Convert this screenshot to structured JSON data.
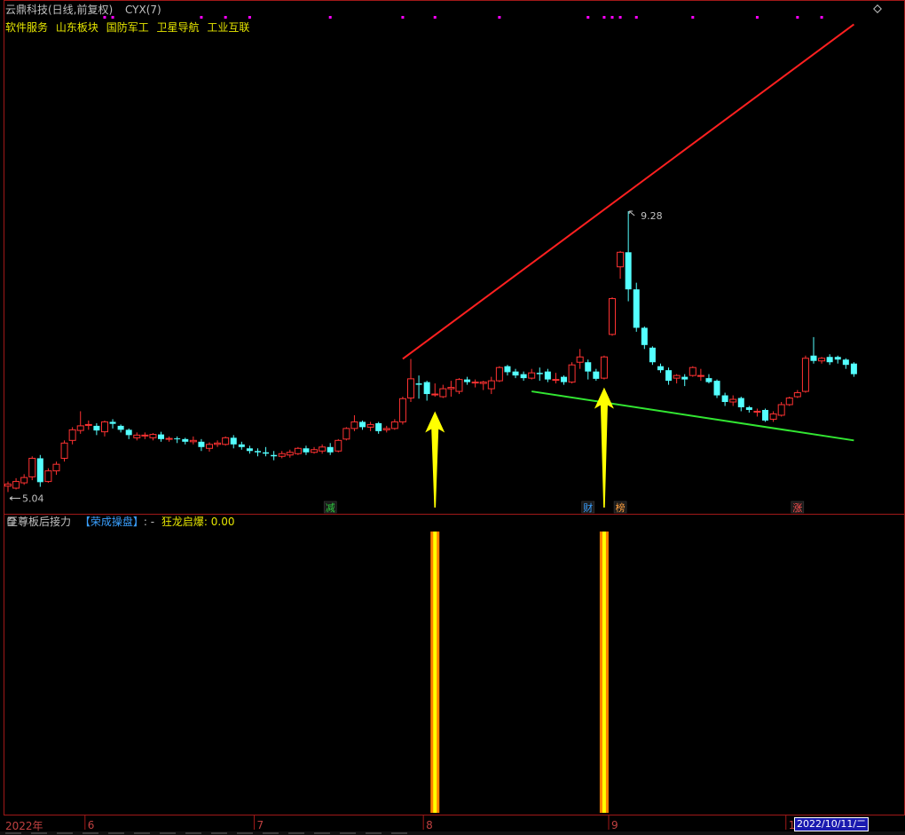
{
  "header": {
    "stock": "云鼎科技(日线,前复权)",
    "indicator": "CYX(7)",
    "sectors": [
      "软件服务",
      "山东板块",
      "国防军工",
      "卫星导航",
      "工业互联"
    ]
  },
  "sub_header": {
    "name": "至尊板后接力",
    "tag": "【荣成操盘】",
    "separator": ": -",
    "value_label": "狂龙启爆:",
    "value": "0.00"
  },
  "x_axis": {
    "year_label": "2022年",
    "months": [
      "6",
      "7",
      "8",
      "9",
      "1"
    ],
    "cursor_date": "2022/10/11/二"
  },
  "markers": [
    {
      "label": "减",
      "color": "#2ecc40"
    },
    {
      "label": "财",
      "color": "#3aa0ff"
    },
    {
      "label": "榜",
      "color": "#ffa040"
    },
    {
      "label": "涨",
      "color": "#ff5050"
    }
  ],
  "colors": {
    "up": "#ff3232",
    "down": "#54ffff",
    "trend_up": "#ff2020",
    "trend_support": "#32e632",
    "arrow": "#ffff00",
    "signal_outer": "#ff8000",
    "signal_inner": "#ffff00",
    "magenta_dot": "#ff00ff"
  },
  "chart_data": {
    "type": "candlestick",
    "price_labels": {
      "high": "9.28",
      "low": "5.04"
    },
    "price_range": [
      4.9,
      12.2
    ],
    "candles": [
      [
        5.13,
        5.16,
        5.04,
        5.2
      ],
      [
        5.1,
        5.2,
        5.08,
        5.25
      ],
      [
        5.18,
        5.26,
        5.15,
        5.31
      ],
      [
        5.27,
        5.55,
        5.22,
        5.58
      ],
      [
        5.55,
        5.19,
        5.12,
        5.6
      ],
      [
        5.2,
        5.36,
        5.18,
        5.4
      ],
      [
        5.36,
        5.46,
        5.3,
        5.5
      ],
      [
        5.55,
        5.78,
        5.5,
        5.82
      ],
      [
        5.82,
        5.98,
        5.76,
        6.02
      ],
      [
        5.97,
        6.04,
        5.92,
        6.26
      ],
      [
        6.06,
        6.06,
        5.98,
        6.12
      ],
      [
        6.04,
        5.97,
        5.9,
        6.08
      ],
      [
        5.95,
        6.1,
        5.88,
        6.12
      ],
      [
        6.1,
        6.07,
        6.0,
        6.14
      ],
      [
        6.04,
        5.98,
        5.94,
        6.06
      ],
      [
        5.98,
        5.9,
        5.84,
        6.0
      ],
      [
        5.86,
        5.9,
        5.82,
        5.94
      ],
      [
        5.9,
        5.9,
        5.84,
        5.94
      ],
      [
        5.86,
        5.91,
        5.82,
        5.93
      ],
      [
        5.91,
        5.84,
        5.8,
        5.95
      ],
      [
        5.84,
        5.85,
        5.8,
        5.88
      ],
      [
        5.85,
        5.84,
        5.78,
        5.88
      ],
      [
        5.84,
        5.8,
        5.76,
        5.86
      ],
      [
        5.8,
        5.82,
        5.76,
        5.88
      ],
      [
        5.8,
        5.72,
        5.66,
        5.84
      ],
      [
        5.7,
        5.76,
        5.65,
        5.79
      ],
      [
        5.76,
        5.78,
        5.72,
        5.82
      ],
      [
        5.76,
        5.86,
        5.74,
        5.88
      ],
      [
        5.86,
        5.76,
        5.7,
        5.9
      ],
      [
        5.76,
        5.72,
        5.68,
        5.8
      ],
      [
        5.7,
        5.66,
        5.62,
        5.74
      ],
      [
        5.66,
        5.64,
        5.58,
        5.7
      ],
      [
        5.64,
        5.62,
        5.58,
        5.72
      ],
      [
        5.6,
        5.58,
        5.52,
        5.66
      ],
      [
        5.58,
        5.62,
        5.55,
        5.66
      ],
      [
        5.6,
        5.64,
        5.56,
        5.68
      ],
      [
        5.62,
        5.7,
        5.6,
        5.72
      ],
      [
        5.7,
        5.64,
        5.6,
        5.74
      ],
      [
        5.64,
        5.68,
        5.62,
        5.72
      ],
      [
        5.66,
        5.72,
        5.62,
        5.76
      ],
      [
        5.72,
        5.64,
        5.6,
        5.78
      ],
      [
        5.66,
        5.82,
        5.64,
        5.84
      ],
      [
        5.84,
        6.0,
        5.82,
        6.02
      ],
      [
        6.0,
        6.1,
        5.96,
        6.2
      ],
      [
        6.1,
        6.02,
        5.98,
        6.12
      ],
      [
        6.02,
        6.06,
        5.96,
        6.1
      ],
      [
        6.08,
        5.96,
        5.92,
        6.1
      ],
      [
        5.98,
        6.0,
        5.94,
        6.04
      ],
      [
        6.0,
        6.1,
        5.98,
        6.14
      ],
      [
        6.1,
        6.45,
        6.06,
        6.48
      ],
      [
        6.46,
        6.75,
        6.4,
        7.05
      ],
      [
        6.68,
        6.66,
        6.45,
        6.8
      ],
      [
        6.7,
        6.52,
        6.42,
        6.72
      ],
      [
        6.52,
        6.52,
        6.48,
        6.68
      ],
      [
        6.48,
        6.6,
        6.46,
        6.66
      ],
      [
        6.6,
        6.62,
        6.48,
        6.72
      ],
      [
        6.56,
        6.74,
        6.52,
        6.76
      ],
      [
        6.74,
        6.7,
        6.66,
        6.78
      ],
      [
        6.7,
        6.7,
        6.62,
        6.74
      ],
      [
        6.68,
        6.7,
        6.58,
        6.72
      ],
      [
        6.6,
        6.72,
        6.52,
        6.78
      ],
      [
        6.72,
        6.92,
        6.7,
        6.94
      ],
      [
        6.94,
        6.85,
        6.8,
        6.96
      ],
      [
        6.86,
        6.8,
        6.76,
        6.9
      ],
      [
        6.82,
        6.76,
        6.72,
        6.86
      ],
      [
        6.76,
        6.84,
        6.74,
        6.9
      ],
      [
        6.84,
        6.82,
        6.72,
        6.92
      ],
      [
        6.86,
        6.74,
        6.7,
        6.9
      ],
      [
        6.74,
        6.74,
        6.68,
        6.84
      ],
      [
        6.78,
        6.7,
        6.66,
        6.8
      ],
      [
        6.7,
        6.96,
        6.68,
        7.0
      ],
      [
        7.0,
        7.08,
        6.9,
        7.2
      ],
      [
        7.0,
        6.86,
        6.74,
        7.04
      ],
      [
        6.86,
        6.75,
        6.72,
        6.9
      ],
      [
        6.76,
        7.08,
        6.74,
        7.1
      ],
      [
        7.42,
        7.96,
        7.4,
        7.98
      ],
      [
        8.44,
        8.66,
        8.26,
        8.68
      ],
      [
        8.66,
        8.1,
        7.92,
        9.28
      ],
      [
        8.1,
        7.52,
        7.46,
        8.2
      ],
      [
        7.52,
        7.26,
        7.2,
        7.54
      ],
      [
        7.22,
        7.0,
        6.96,
        7.24
      ],
      [
        6.94,
        6.88,
        6.84,
        6.98
      ],
      [
        6.88,
        6.72,
        6.66,
        6.92
      ],
      [
        6.76,
        6.8,
        6.68,
        6.82
      ],
      [
        6.78,
        6.74,
        6.64,
        6.82
      ],
      [
        6.8,
        6.92,
        6.78,
        6.94
      ],
      [
        6.8,
        6.8,
        6.72,
        6.9
      ],
      [
        6.76,
        6.7,
        6.68,
        6.82
      ],
      [
        6.72,
        6.5,
        6.46,
        6.74
      ],
      [
        6.5,
        6.4,
        6.34,
        6.54
      ],
      [
        6.4,
        6.44,
        6.34,
        6.5
      ],
      [
        6.46,
        6.32,
        6.26,
        6.48
      ],
      [
        6.32,
        6.28,
        6.24,
        6.34
      ],
      [
        6.26,
        6.26,
        6.18,
        6.3
      ],
      [
        6.28,
        6.12,
        6.1,
        6.3
      ],
      [
        6.14,
        6.22,
        6.1,
        6.26
      ],
      [
        6.2,
        6.36,
        6.18,
        6.4
      ],
      [
        6.36,
        6.46,
        6.34,
        6.48
      ],
      [
        6.48,
        6.54,
        6.46,
        6.58
      ],
      [
        6.56,
        7.06,
        6.54,
        7.1
      ],
      [
        7.1,
        7.02,
        6.98,
        7.38
      ],
      [
        7.02,
        7.06,
        6.98,
        7.08
      ],
      [
        7.08,
        7.0,
        6.96,
        7.12
      ],
      [
        7.08,
        7.04,
        6.98,
        7.1
      ],
      [
        7.04,
        6.96,
        6.9,
        7.06
      ],
      [
        6.98,
        6.82,
        6.78,
        7.0
      ]
    ],
    "trend_up": {
      "from": [
        49,
        7.05
      ],
      "to": [
        105,
        12.1
      ]
    },
    "trend_support": {
      "from": [
        65,
        6.56
      ],
      "to": [
        105,
        5.82
      ]
    },
    "signals": [
      {
        "candle": 53,
        "arrow_value": 6.26
      },
      {
        "candle": 74,
        "arrow_value": 6.62
      }
    ],
    "marker_candles": [
      40,
      72,
      76,
      98
    ],
    "magenta_dots": [
      12,
      13,
      24,
      27,
      30,
      40,
      49,
      53,
      61,
      72,
      74,
      75,
      76,
      78,
      85,
      93,
      98,
      101
    ]
  }
}
